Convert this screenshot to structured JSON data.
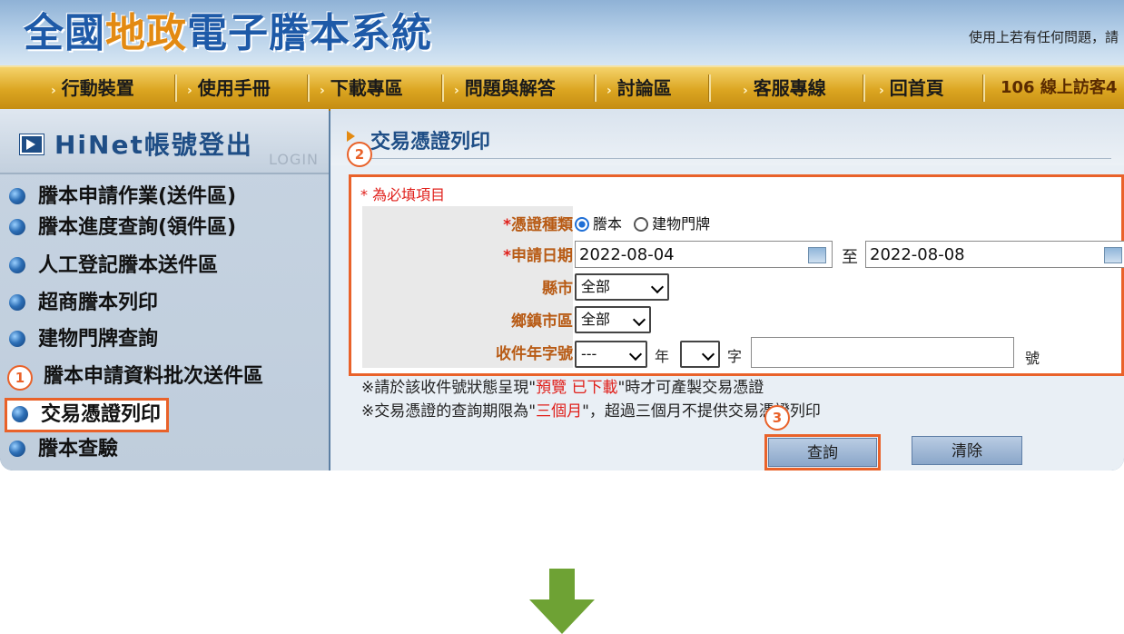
{
  "header": {
    "title_part1": "全國",
    "title_highlight": "地政",
    "title_part2": "電子謄本系統",
    "note": "使用上若有任何問題，請"
  },
  "nav": {
    "items": [
      "行動裝置",
      "使用手冊",
      "下載專區",
      "問題與解答",
      "討論區",
      "客服專線",
      "回首頁"
    ],
    "visitor": "106  線上訪客4"
  },
  "sidebar": {
    "logout_label": "HiNet帳號登出",
    "logout_watermark": "LOGIN",
    "items": [
      {
        "label": "謄本申請作業(送件區)"
      },
      {
        "label": "謄本進度查詢(領件區)"
      },
      {
        "label": "人工登記謄本送件區"
      },
      {
        "label": "超商謄本列印"
      },
      {
        "label": "建物門牌查詢"
      },
      {
        "label": "謄本申請資料批次送件區"
      },
      {
        "label": "交易憑證列印"
      },
      {
        "label": "謄本查驗"
      }
    ]
  },
  "main": {
    "title": "交易憑證列印",
    "required_note": "* 為必填項目",
    "labels": {
      "voucher_type": "憑證種類",
      "apply_date": "申請日期",
      "county": "縣市",
      "township": "鄉鎮市區",
      "receipt_no": "收件年字號"
    },
    "voucher_options": [
      "謄本",
      "建物門牌"
    ],
    "date_from": "2022-08-04",
    "date_to_label": "至",
    "date_to": "2022-08-08",
    "county_value": "全部",
    "township_value": "全部",
    "year_value": "---",
    "year_suffix": "年",
    "word_value": "",
    "word_suffix": "字",
    "number_value": "",
    "number_suffix": "號",
    "note1_a": "※請於該收件號狀態呈現\"",
    "note1_red": "預覽 已下載",
    "note1_b": "\"時才可產製交易憑證",
    "note2_a": "※交易憑證的查詢期限為\"",
    "note2_red": "三個月",
    "note2_b": "\"，超過三個月不提供交易憑證列印",
    "query_button": "查詢",
    "clear_button": "清除"
  },
  "steps": [
    "1",
    "2",
    "3"
  ],
  "colors": {
    "highlight": "#e9622a",
    "arrow": "#6ea234"
  }
}
